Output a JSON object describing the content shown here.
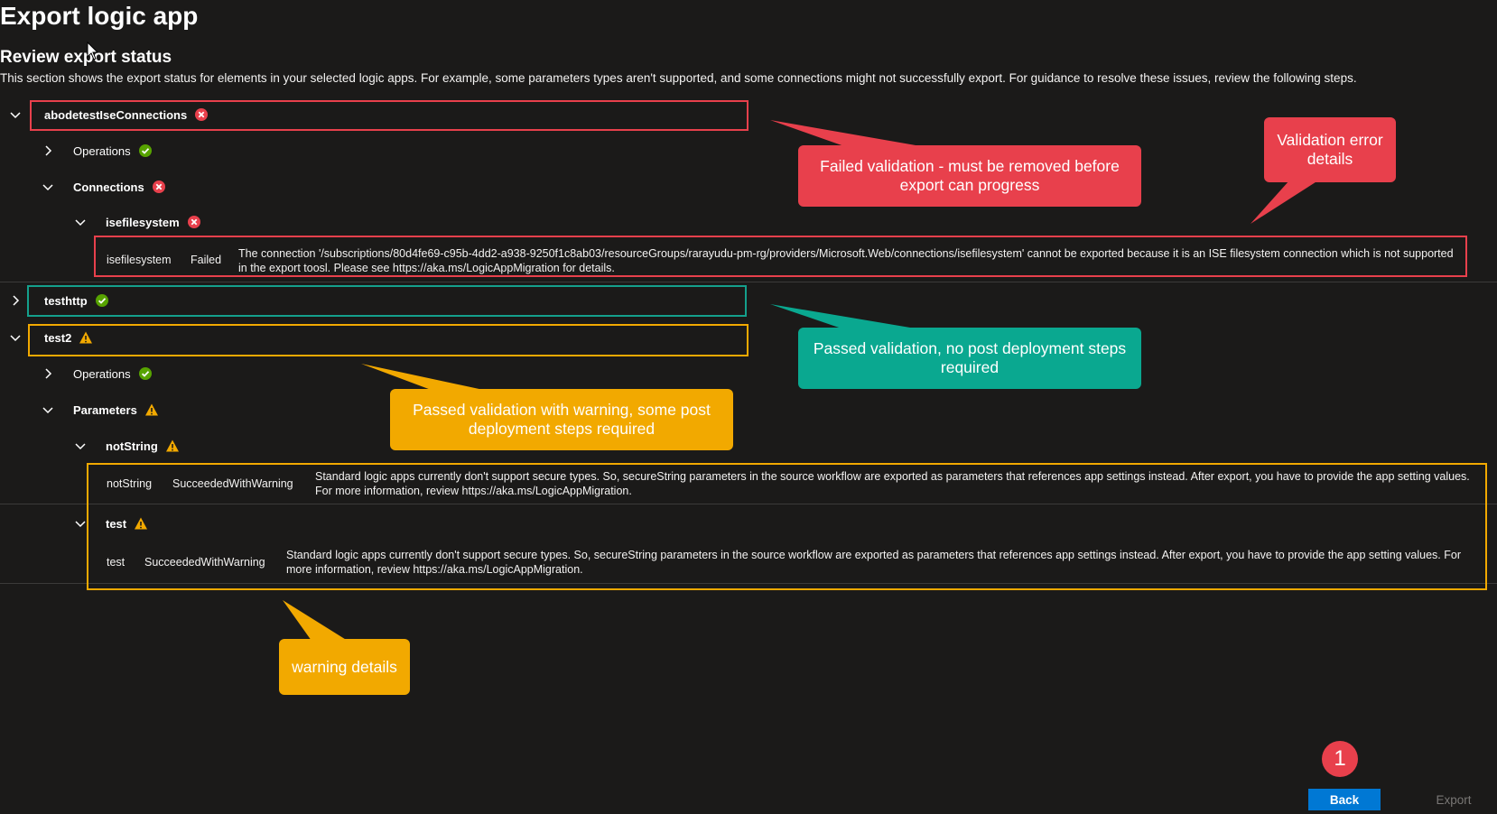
{
  "header": {
    "title": "Export logic app",
    "section_title": "Review export status",
    "section_description": "This section shows the export status for elements in your selected logic apps. For example, some parameters types aren't supported, and some connections might not successfully export. For guidance to resolve these issues, review the following steps."
  },
  "tree": {
    "app1": {
      "label": "abodetestIseConnections",
      "status": "error",
      "operations_label": "Operations",
      "connections_label": "Connections",
      "connection_name": "isefilesystem",
      "detail": {
        "name": "isefilesystem",
        "status": "Failed",
        "message": "The connection '/subscriptions/80d4fe69-c95b-4dd2-a938-9250f1c8ab03/resourceGroups/rarayudu-pm-rg/providers/Microsoft.Web/connections/isefilesystem' cannot be exported because it is an ISE filesystem connection which is not supported in the export toosl. Please see https://aka.ms/LogicAppMigration for details."
      }
    },
    "app2": {
      "label": "testhttp",
      "status": "success"
    },
    "app3": {
      "label": "test2",
      "status": "warning",
      "operations_label": "Operations",
      "parameters_label": "Parameters",
      "param1": {
        "label": "notString",
        "detail_name": "notString",
        "detail_status": "SucceededWithWarning",
        "detail_message": "Standard logic apps currently don't support secure types. So, secureString parameters in the source workflow are exported as parameters that references app settings instead. After export, you have to provide the app setting values. For more information, review https://aka.ms/LogicAppMigration."
      },
      "param2": {
        "label": "test",
        "detail_name": "test",
        "detail_status": "SucceededWithWarning",
        "detail_message": "Standard logic apps currently don't support secure types. So, secureString parameters in the source workflow are exported as parameters that references app settings instead. After export, you have to provide the app setting values. For more information, review https://aka.ms/LogicAppMigration."
      }
    }
  },
  "callouts": {
    "failed": "Failed validation - must be removed before export can progress",
    "validation_error": "Validation error details",
    "passed": "Passed validation, no post deployment steps required",
    "passed_warning": "Passed validation with warning, some post deployment steps required",
    "warning_details": "warning details"
  },
  "footer": {
    "step_number": "1",
    "back_label": "Back",
    "export_label": "Export"
  },
  "colors": {
    "error": "#e8404c",
    "success": "#14a08c",
    "warning": "#f2a900",
    "primary": "#0078d4"
  }
}
